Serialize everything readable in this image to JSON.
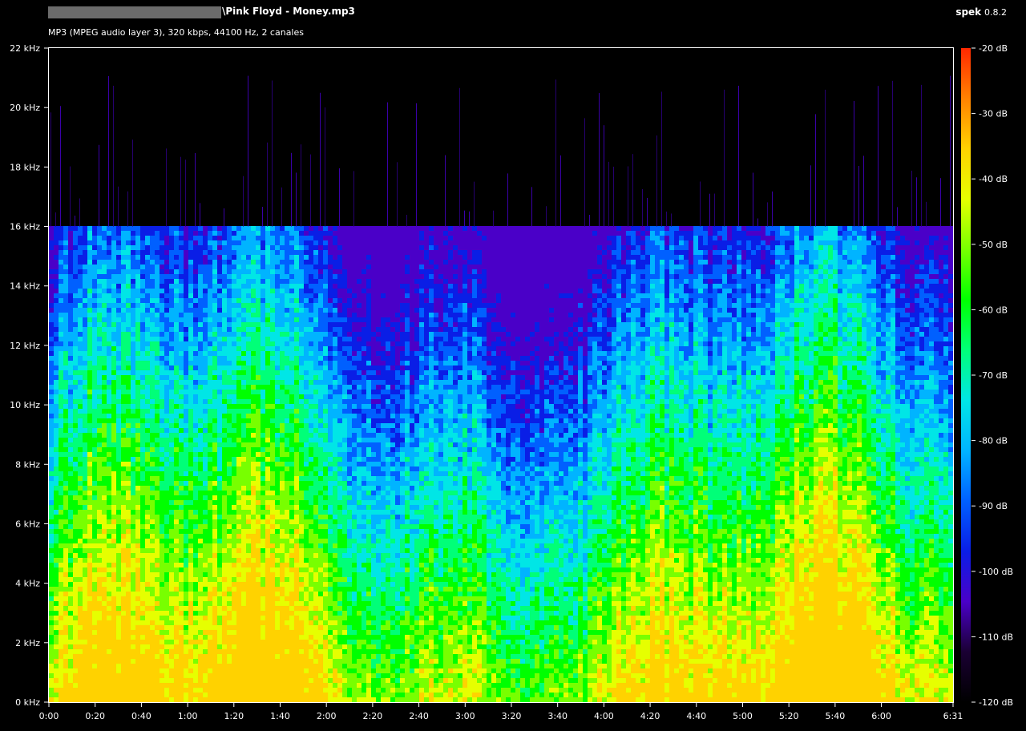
{
  "header": {
    "title": "\\Pink Floyd - Money.mp3",
    "audio_info": "MP3 (MPEG audio layer 3), 320 kbps, 44100 Hz, 2 canales",
    "app_name": "spek",
    "app_version": "0.8.2"
  },
  "chart_data": {
    "type": "heatmap",
    "x_ticks": [
      "0:00",
      "0:20",
      "0:40",
      "1:00",
      "1:20",
      "1:40",
      "2:00",
      "2:20",
      "2:40",
      "3:00",
      "3:20",
      "3:40",
      "4:00",
      "4:20",
      "4:40",
      "5:00",
      "5:20",
      "5:40",
      "6:00",
      "6:31"
    ],
    "x_tick_seconds": [
      0,
      20,
      40,
      60,
      80,
      100,
      120,
      140,
      160,
      180,
      200,
      220,
      240,
      260,
      280,
      300,
      320,
      340,
      360,
      391
    ],
    "xlim_seconds": [
      0,
      391
    ],
    "y_ticks": [
      "0 kHz",
      "2 kHz",
      "4 kHz",
      "6 kHz",
      "8 kHz",
      "10 kHz",
      "12 kHz",
      "14 kHz",
      "16 kHz",
      "18 kHz",
      "20 kHz",
      "22 kHz"
    ],
    "ylim_khz": [
      0,
      22
    ],
    "lowpass_cutoff_khz": 16,
    "colorbar": {
      "labels": [
        "-20 dB",
        "-30 dB",
        "-40 dB",
        "-50 dB",
        "-60 dB",
        "-70 dB",
        "-80 dB",
        "-90 dB",
        "-100 dB",
        "-110 dB",
        "-120 dB"
      ],
      "range_db": [
        -120,
        -20
      ],
      "colors": [
        "#000000",
        "#1a0033",
        "#4a00c8",
        "#0a1ee6",
        "#0060ff",
        "#00b4ff",
        "#00e6e6",
        "#00ff78",
        "#00ff00",
        "#78ff00",
        "#e6ff00",
        "#ffd200",
        "#ff8200",
        "#ff2800"
      ]
    }
  }
}
